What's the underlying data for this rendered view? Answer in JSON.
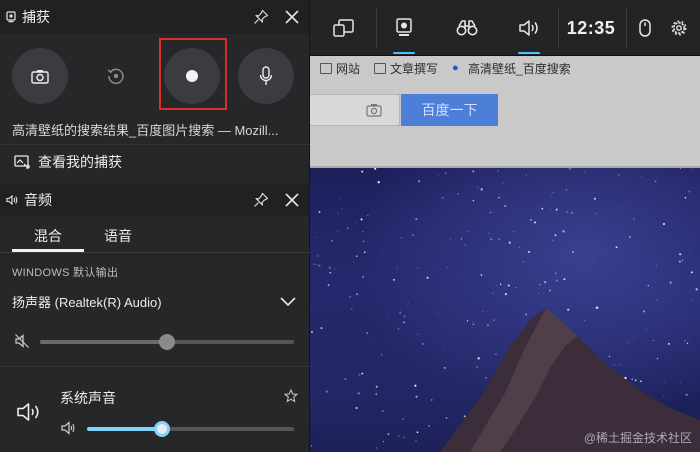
{
  "browser_bg": {
    "bookmarks": [
      {
        "icon": "checkbox-icon",
        "label": "网站"
      },
      {
        "icon": "checkbox-icon",
        "label": "文章撰写"
      },
      {
        "icon": "baidu-paw-icon",
        "label": "高清壁纸_百度搜索"
      }
    ],
    "search_button": "百度一下",
    "watermark": "@稀土掘金技术社区"
  },
  "gamebar": {
    "time": "12:35",
    "active_color": "#4cc2ff"
  },
  "capture": {
    "title": "捕获",
    "buttons": [
      {
        "name": "screenshot-button",
        "icon": "camera-icon"
      },
      {
        "name": "record-last-button",
        "icon": "replay-icon"
      },
      {
        "name": "record-button",
        "icon": "record-dot-icon"
      },
      {
        "name": "microphone-button",
        "icon": "microphone-icon"
      }
    ],
    "caption": "高清壁纸的搜索结果_百度图片搜索 — Mozill...",
    "view_captures": "查看我的捕获"
  },
  "audio": {
    "title": "音频",
    "tabs": [
      "混合",
      "语音"
    ],
    "active_tab": 0,
    "section_label": "WINDOWS 默认输出",
    "device": "扬声器 (Realtek(R) Audio)",
    "master_volume": 0.5,
    "app_name": "系统声音",
    "app_volume": 0.36,
    "slider_accent": "#7fd3ff"
  }
}
